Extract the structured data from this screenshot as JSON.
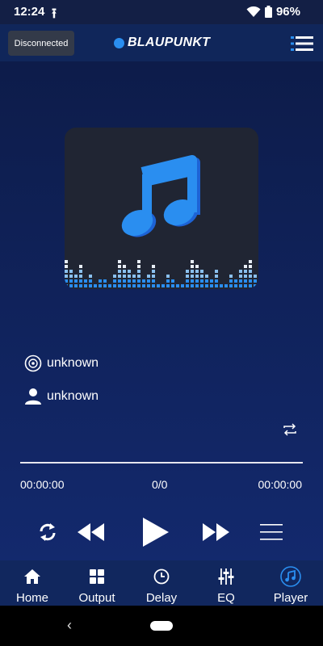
{
  "status": {
    "time": "12:24",
    "battery": "96%"
  },
  "header": {
    "connection_status": "Disconnected",
    "brand": "BLAUPUNKT"
  },
  "player": {
    "album": "unknown",
    "artist": "unknown",
    "elapsed": "00:00:00",
    "track_counter": "0/0",
    "duration": "00:00:00",
    "progress": 0
  },
  "tabs": [
    {
      "label": "Home",
      "icon": "home-icon"
    },
    {
      "label": "Output",
      "icon": "grid-icon"
    },
    {
      "label": "Delay",
      "icon": "clock-icon"
    },
    {
      "label": "EQ",
      "icon": "sliders-icon"
    },
    {
      "label": "Player",
      "icon": "music-note-icon",
      "active": true
    }
  ],
  "colors": {
    "accent": "#2a8ef0",
    "tab_bar": "#11275e",
    "header": "#10265a"
  }
}
